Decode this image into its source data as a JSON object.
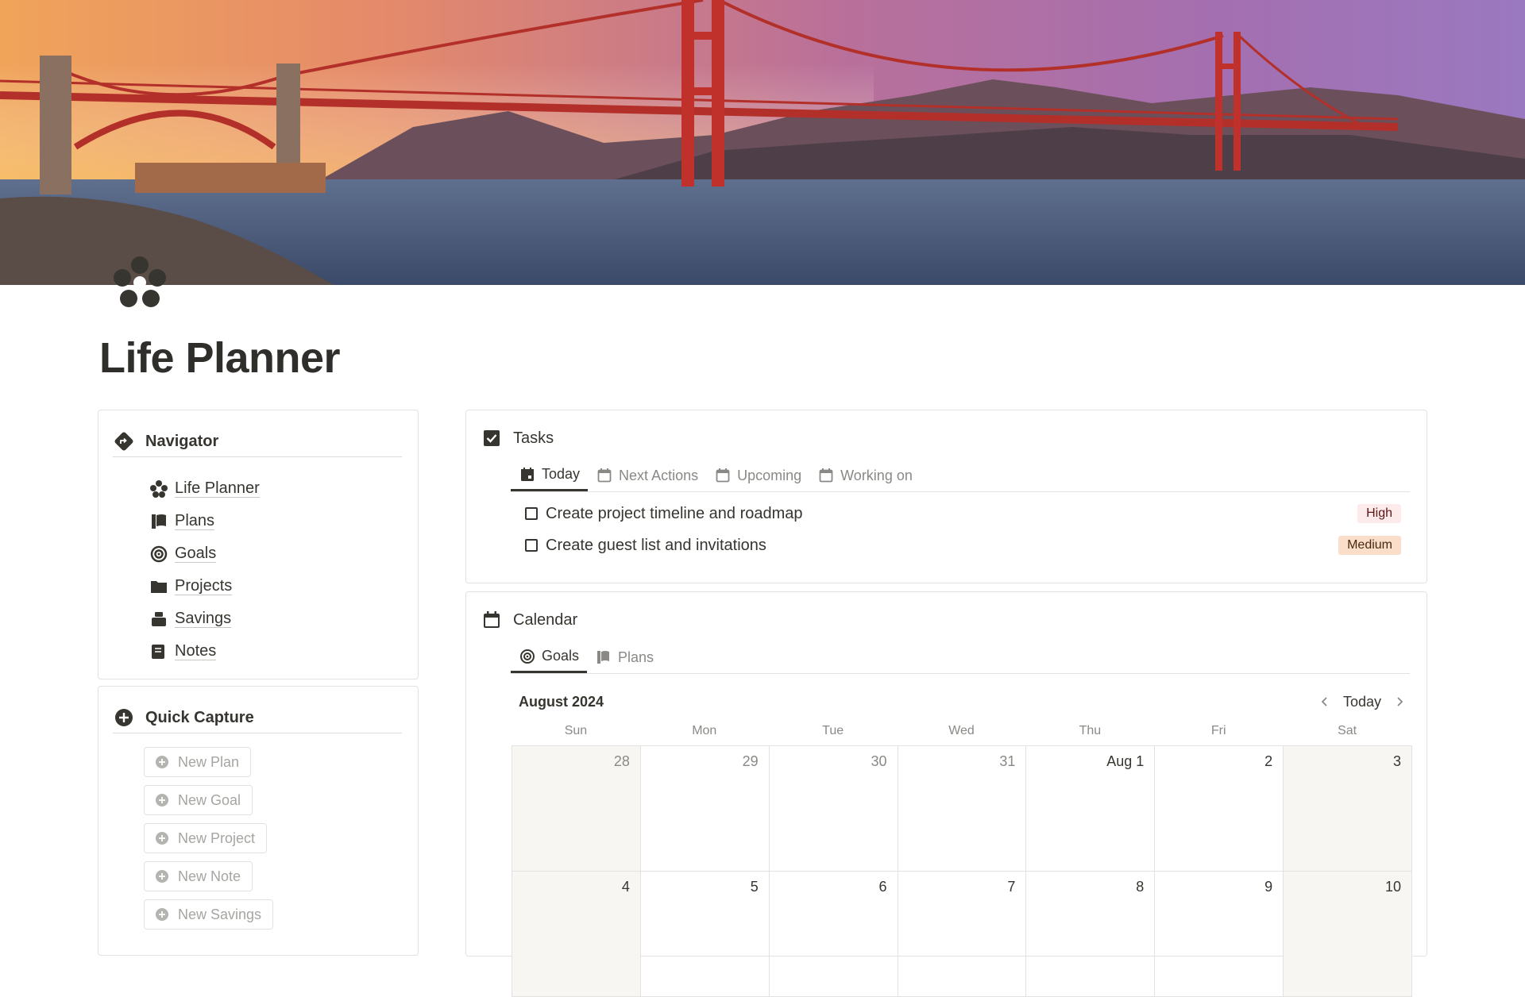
{
  "page": {
    "title": "Life Planner"
  },
  "navigator": {
    "title": "Navigator",
    "items": [
      {
        "label": "Life Planner",
        "icon": "life-planner-icon"
      },
      {
        "label": "Plans",
        "icon": "plans-icon"
      },
      {
        "label": "Goals",
        "icon": "goals-icon"
      },
      {
        "label": "Projects",
        "icon": "projects-icon"
      },
      {
        "label": "Savings",
        "icon": "savings-icon"
      },
      {
        "label": "Notes",
        "icon": "notes-icon"
      }
    ]
  },
  "quick_capture": {
    "title": "Quick Capture",
    "buttons": [
      "New Plan",
      "New Goal",
      "New Project",
      "New Note",
      "New Savings"
    ]
  },
  "tasks": {
    "title": "Tasks",
    "tabs": [
      "Today",
      "Next Actions",
      "Upcoming",
      "Working on"
    ],
    "active_tab": "Today",
    "items": [
      {
        "text": "Create project timeline and roadmap",
        "priority": "High",
        "priority_bg": "#fdebec",
        "priority_fg": "#5d1715"
      },
      {
        "text": "Create guest list and invitations",
        "priority": "Medium",
        "priority_bg": "#fadec9",
        "priority_fg": "#49290e"
      }
    ]
  },
  "calendar": {
    "title": "Calendar",
    "tabs": [
      "Goals",
      "Plans"
    ],
    "active_tab": "Goals",
    "month": "August 2024",
    "today_label": "Today",
    "weekdays": [
      "Sun",
      "Mon",
      "Tue",
      "Wed",
      "Thu",
      "Fri",
      "Sat"
    ],
    "rows": [
      [
        "28",
        "29",
        "30",
        "31",
        "Aug 1",
        "2",
        "3"
      ],
      [
        "4",
        "5",
        "6",
        "7",
        "8",
        "9",
        "10"
      ]
    ]
  }
}
